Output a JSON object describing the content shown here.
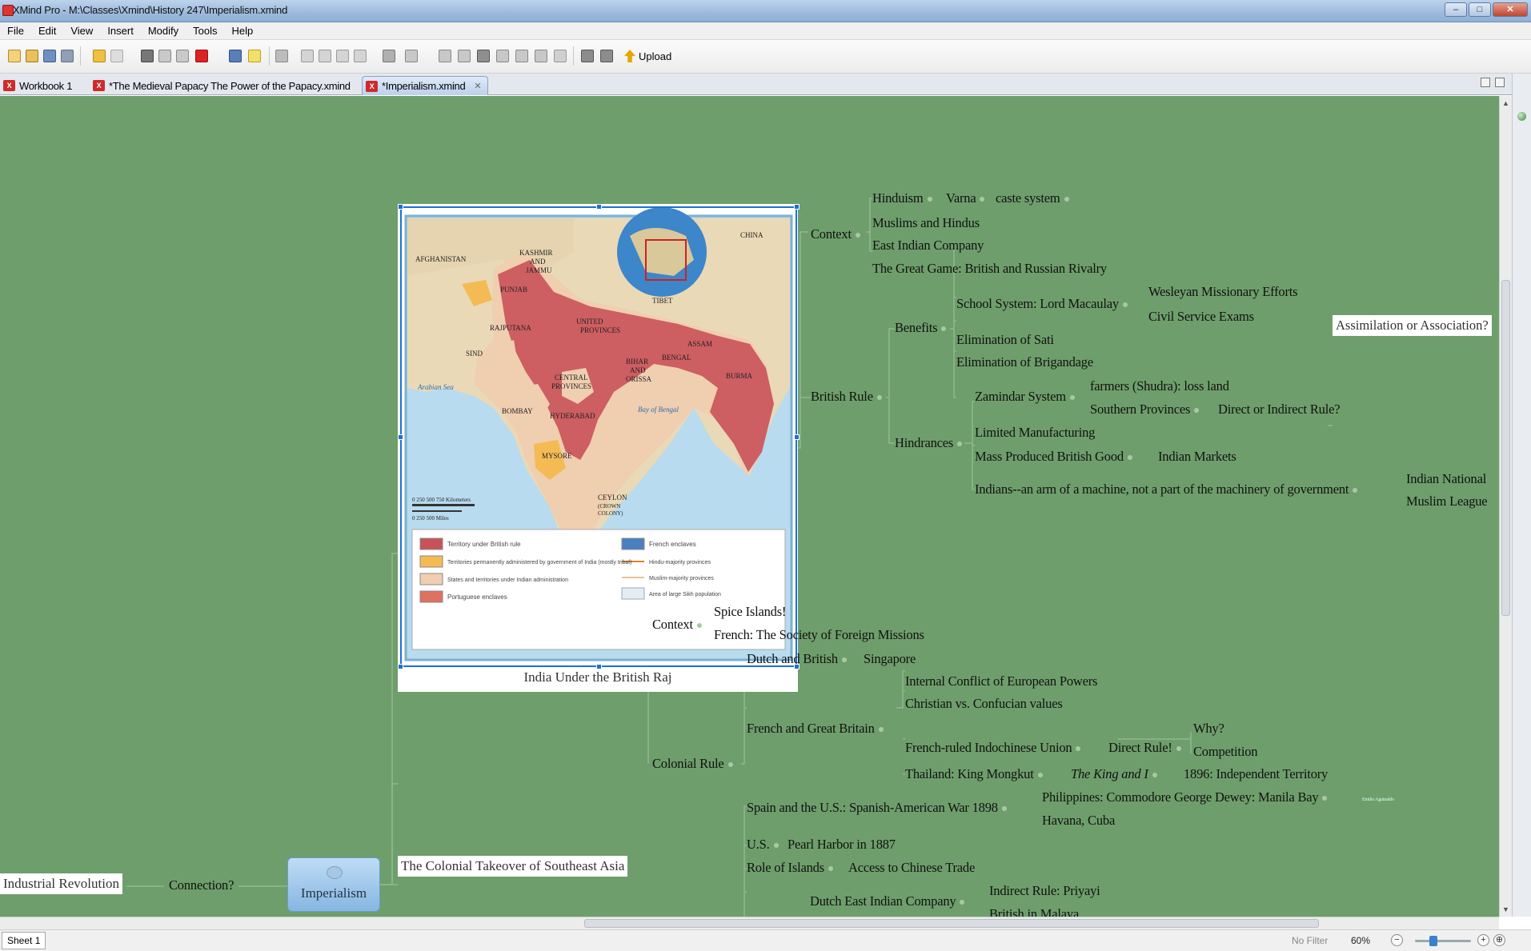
{
  "window": {
    "title": "XMind Pro - M:\\Classes\\Xmind\\History 247\\Imperialism.xmind",
    "min": "–",
    "max": "□",
    "close": "✕"
  },
  "menu": [
    "File",
    "Edit",
    "View",
    "Insert",
    "Modify",
    "Tools",
    "Help"
  ],
  "toolbar": {
    "upload_label": "Upload"
  },
  "tabs": [
    {
      "label": "Workbook 1"
    },
    {
      "label": "*The Medieval Papacy  The Power of the Papacy.xmind"
    },
    {
      "label": "*Imperialism.xmind"
    }
  ],
  "mindmap": {
    "central": "Imperialism",
    "left_topic": "Connection?",
    "left_endpoint": "Industrial Revolution",
    "map_image": {
      "caption": "India Under the British Raj",
      "icon": "map-of-india-image",
      "labels": {
        "china": "CHINA",
        "afghanistan": "AFGHANISTAN",
        "kashmir": "KASHMIR",
        "and": "AND",
        "jammu": "JAMMU",
        "punjab": "PUNJAB",
        "tibet": "TIBET",
        "rajputana": "RAJPUTANA",
        "united": "UNITED",
        "provinces": "PROVINCES",
        "sind": "SIND",
        "assam": "ASSAM",
        "bengal": "BENGAL",
        "bihar": "BIHAR",
        "and2": "AND",
        "orissa": "ORISSA",
        "burma": "BURMA",
        "central": "CENTRAL",
        "provinces2": "PROVINCES",
        "arabian": "Arabian Sea",
        "bombay": "BOMBAY",
        "hyderabad": "HYDERABAD",
        "bay": "Bay of Bengal",
        "mysore": "MYSORE",
        "ceylon": "CEYLON",
        "crown": "(CROWN",
        "colony": "COLONY)",
        "km": "0   250   500   750 Kilometers",
        "mi": "0      250      500 Miles"
      },
      "legend": [
        "Territory under British rule",
        "Territories permanently administered by government of India (mostly tribal)",
        "States and territories under Indian administration",
        "Portuguese enclaves",
        "French enclaves",
        "Hindu-majority provinces",
        "Muslim-majority provinces",
        "Area of large Sikh population"
      ]
    },
    "india": {
      "context": "Context",
      "context_items": [
        "Hinduism",
        "Varna",
        "caste system",
        "Muslims and Hindus",
        "East Indian Company",
        "The Great Game: British and Russian Rivalry"
      ],
      "british_rule": "British Rule",
      "benefits": "Benefits",
      "benefits_items": [
        "School System: Lord Macaulay",
        "Wesleyan Missionary Efforts",
        "Civil Service Exams",
        "Elimination of Sati",
        "Elimination of Brigandage"
      ],
      "assimilation": "Assimilation or Association?",
      "hindrances": "Hindrances",
      "hindrance_items": [
        "Zamindar System",
        "farmers (Shudra): loss land",
        "Southern Provinces",
        "Direct or Indirect Rule?",
        "Limited Manufacturing",
        "Mass Produced British Good",
        "Indian Markets",
        "Indians--an arm of a machine, not a part of the machinery of government",
        "Indian National",
        "Muslim League"
      ]
    },
    "sea": {
      "title": "The Colonial Takeover of Southeast Asia",
      "context": "Context",
      "context_items": [
        "Spice Islands!",
        "French: The Society of Foreign Missions"
      ],
      "colonial_rule": "Colonial Rule",
      "items": [
        "Dutch and British",
        "Singapore",
        "Internal Conflict of European Powers",
        "Christian vs. Confucian values",
        "French and Great Britain",
        "French-ruled Indochinese Union",
        "Direct Rule!",
        "Why?",
        "Competition",
        "Thailand: King Mongkut",
        "The King and I",
        "1896: Independent Territory",
        "Spain and the U.S.: Spanish-American War 1898",
        "Philippines: Commodore George Dewey: Manila Bay",
        "Emilio Aguinaldo",
        "Havana, Cuba",
        "U.S.",
        "Pearl Harbor in 1887",
        "Role of Islands",
        "Access to Chinese Trade",
        "Dutch East Indian Company",
        "Indirect Rule: Priyayi",
        "British in Malaya"
      ]
    }
  },
  "status": {
    "sheet": "Sheet 1",
    "filter": "No Filter",
    "zoom": "60%",
    "zoom_fraction": 0.3
  }
}
